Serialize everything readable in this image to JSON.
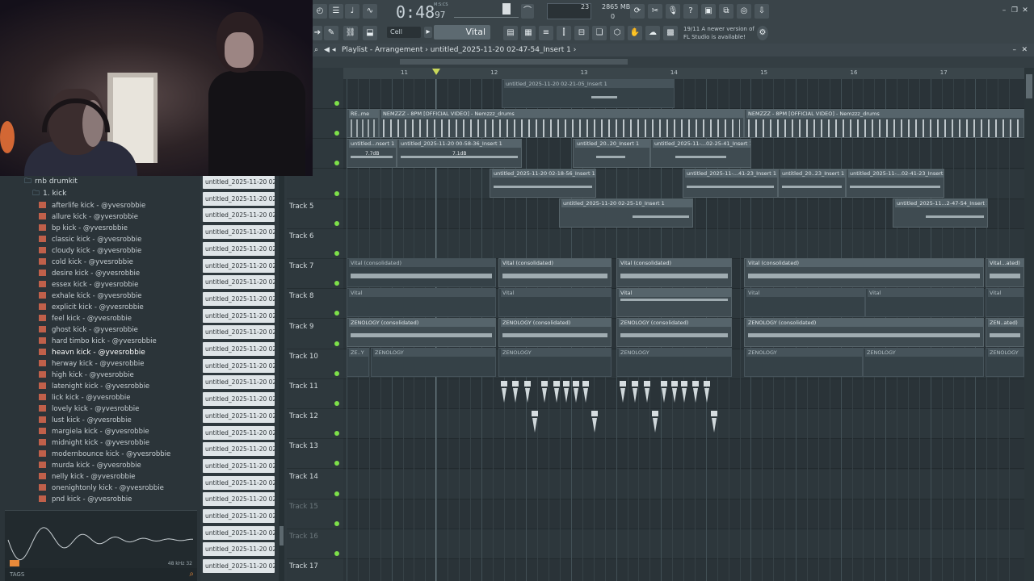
{
  "toolbar": {
    "time_main": "0:48",
    "time_sub": "97",
    "time_unit": "M:S:CS",
    "cpu_value": "23",
    "cpu_value2": "0",
    "memory": "2865 MB",
    "snap": "Cell",
    "plugin": "Vital",
    "update_line1": "19/11  A newer version of",
    "update_line2": "FL Studio is available!"
  },
  "playlist": {
    "title": "Playlist - Arrangement",
    "separator": "›",
    "project": "untitled_2025-11-20 02-47-54_Insert 1",
    "end_chevron": "›"
  },
  "browser": {
    "folder": "rnb drumkit",
    "subfolder": "1. kick",
    "items": [
      "afterlife kick - @yvesrobbie",
      "allure kick - @yvesrobbie",
      "bp kick - @yvesrobbie",
      "classic kick - @yvesrobbie",
      "cloudy kick - @yvesrobbie",
      "cold kick - @yvesrobbie",
      "desire kick - @yvesrobbie",
      "essex kick - @yvesrobbie",
      "exhale kick - @yvesrobbie",
      "explicit kick - @yvesrobbie",
      "feel kick - @yvesrobbie",
      "ghost kick - @yvesrobbie",
      "hard timbo kick - @yvesrobbie",
      "heavn kick - @yvesrobbie",
      "herway kick - @yvesrobbie",
      "high kick - @yvesrobbie",
      "latenight kick - @yvesrobbie",
      "lick kick - @yvesrobbie",
      "lovely kick - @yvesrobbie",
      "lust kick - @yvesrobbie",
      "margiela kick - @yvesrobbie",
      "midnight kick - @yvesrobbie",
      "modernbounce kick - @yvesrobbie",
      "murda kick - @yvesrobbie",
      "nelly kick - @yvesrobbie",
      "onenightonly kick - @yvesrobbie",
      "pnd kick - @yvesrobbie"
    ],
    "selected_index": 13,
    "preview_meta": "48 kHz 32",
    "tags_label": "TAGS"
  },
  "clips": {
    "label": "untitled_2025-11-20 02-..."
  },
  "ruler": {
    "bars": [
      "11",
      "12",
      "13",
      "14",
      "15",
      "16",
      "17"
    ]
  },
  "tracks": [
    {
      "name": "",
      "muted": false
    },
    {
      "name": "",
      "muted": false
    },
    {
      "name": "",
      "muted": false
    },
    {
      "name": "",
      "muted": false
    },
    {
      "name": "Track 5",
      "muted": false
    },
    {
      "name": "Track 6",
      "muted": false
    },
    {
      "name": "Track 7",
      "muted": false
    },
    {
      "name": "Track 8",
      "muted": false
    },
    {
      "name": "Track 9",
      "muted": false
    },
    {
      "name": "Track 10",
      "muted": false
    },
    {
      "name": "Track 11",
      "muted": false
    },
    {
      "name": "Track 12",
      "muted": false
    },
    {
      "name": "Track 13",
      "muted": false
    },
    {
      "name": "Track 14",
      "muted": false
    },
    {
      "name": "Track 15",
      "muted": true
    },
    {
      "name": "Track 16",
      "muted": true
    },
    {
      "name": "Track 17",
      "muted": false
    }
  ],
  "clip_titles": {
    "t1": "untitled_2025-11-20 02-21-05_Insert 1",
    "t2a": "RE..me",
    "t2b": "NEMZZZ - 8PM [OFFICIAL VIDEO] - Nemzzz_drums",
    "t2c": "NEMZZZ - 8PM [OFFICIAL VIDEO] - Nemzzz_drums",
    "t3a": "untitled...nsert 1",
    "t3b": "untitled_2025-11-20 00-58-36_Insert 1",
    "t3c": "untitled_20..20_Insert 1",
    "t3d": "untitled_2025-11-...02-25-41_Insert 1",
    "gain1": "7.7dB",
    "gain2": "7.1dB",
    "t4a": "untitled_2025-11-20 02-18-56_Insert 1",
    "t4b": "untitled_2025-11-...41-23_Insert 1",
    "t4c": "untitled_20..23_Insert 1",
    "t4d": "untitled_2025-11-...02-41-23_Insert 1",
    "t5a": "untitled_2025-11-20 02-25-10_Insert 1",
    "t5b": "untitled_2025-11...2-47-54_Insert 1",
    "vital_cons": "Vital (consolidated)",
    "vital_cons_short": "Vital...ated)",
    "vital": "Vital",
    "zen_cons": "ZENOLOGY (consolidated)",
    "zen_short": "ZEN..ated)",
    "zen": "ZENOLOGY",
    "zen_tiny": "ZE..Y"
  }
}
